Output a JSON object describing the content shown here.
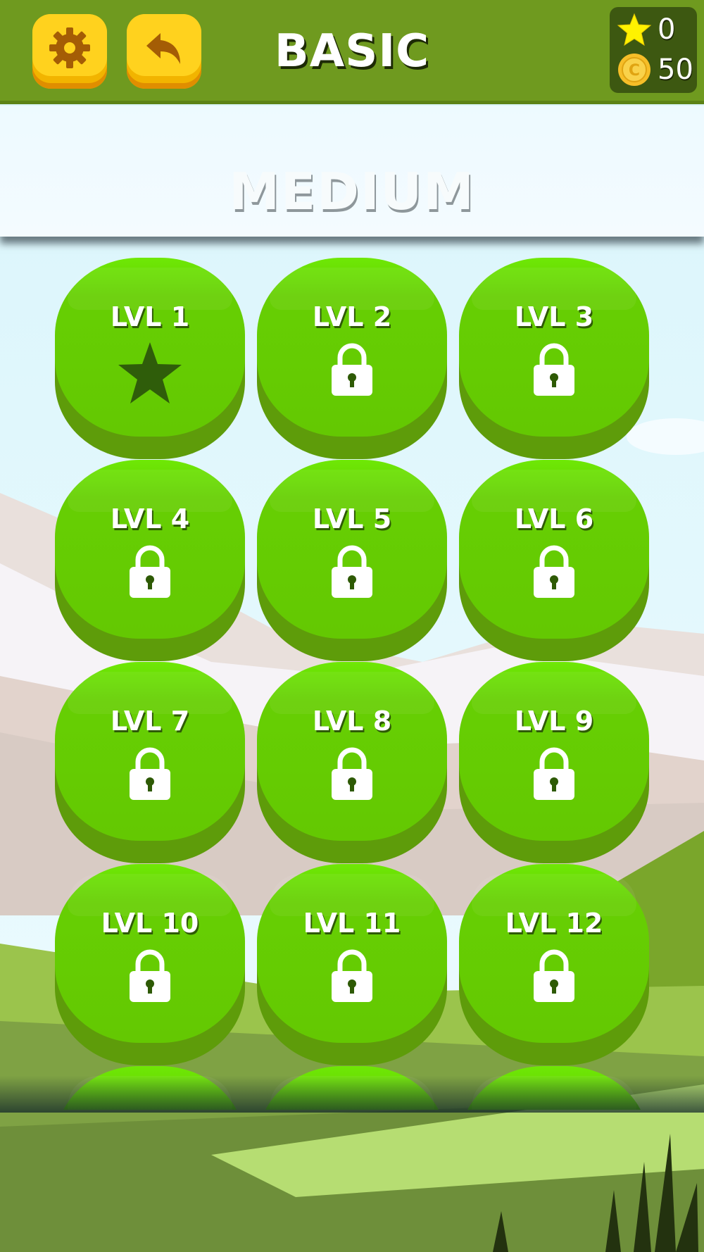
{
  "header": {
    "title": "BASIC",
    "stars": "0",
    "coins": "50"
  },
  "banner": {
    "title": "MEDIUM"
  },
  "levels": [
    {
      "label": "LVL 1",
      "status": "completed"
    },
    {
      "label": "LVL 2",
      "status": "locked"
    },
    {
      "label": "LVL 3",
      "status": "locked"
    },
    {
      "label": "LVL 4",
      "status": "locked"
    },
    {
      "label": "LVL 5",
      "status": "locked"
    },
    {
      "label": "LVL 6",
      "status": "locked"
    },
    {
      "label": "LVL 7",
      "status": "locked"
    },
    {
      "label": "LVL 8",
      "status": "locked"
    },
    {
      "label": "LVL 9",
      "status": "locked"
    },
    {
      "label": "LVL 10",
      "status": "locked"
    },
    {
      "label": "LVL 11",
      "status": "locked"
    },
    {
      "label": "LVL 12",
      "status": "locked"
    }
  ],
  "icons": {
    "settings": "gear-icon",
    "back": "back-arrow-icon",
    "star": "star-icon",
    "coin": "coin-icon",
    "locked": "lock-icon",
    "completed": "star-icon"
  },
  "colors": {
    "header": "#6f9a1f",
    "button_yellow": "#ffd21e",
    "level_green": "#66cf03",
    "level_shadow": "#5e9c0a",
    "completed_star": "#2f5d0a"
  }
}
